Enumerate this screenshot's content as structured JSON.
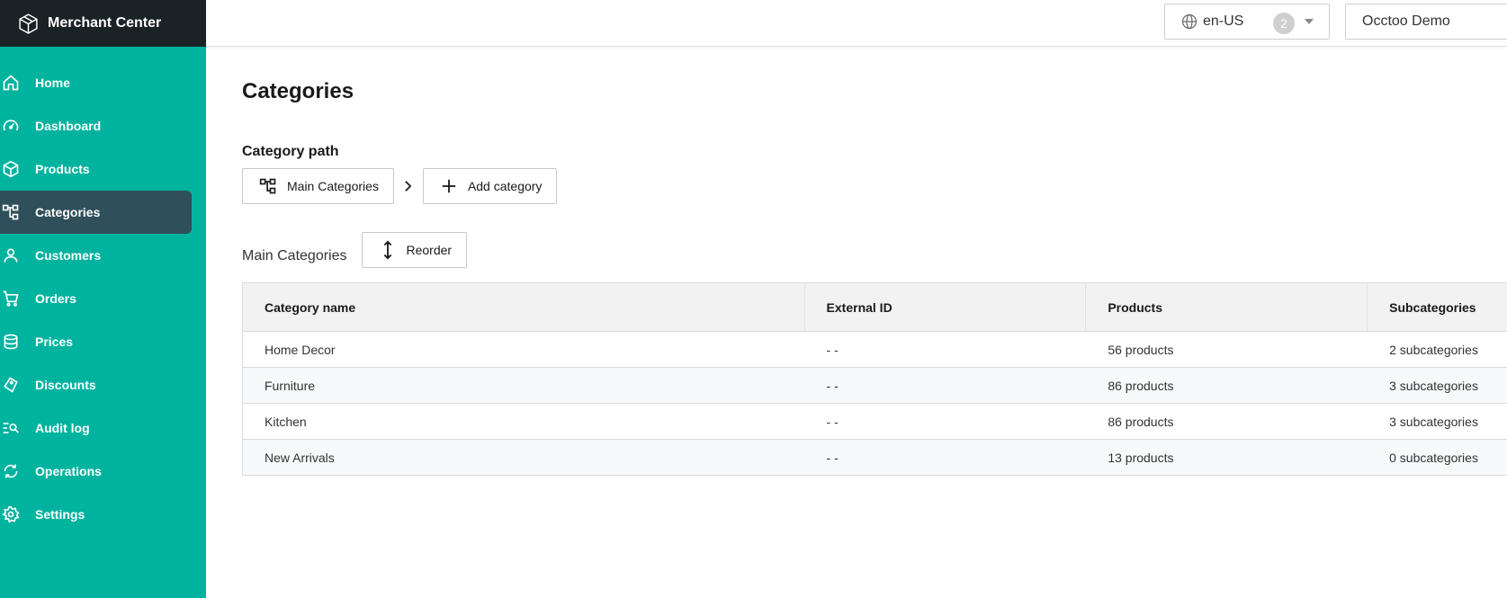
{
  "brand": {
    "title": "Merchant Center",
    "logo_icon": "cube-logo-icon"
  },
  "colors": {
    "sidebar_bg": "#00b39f",
    "brand_bg": "#1a2226",
    "active_item_bg": "#2f4f5a"
  },
  "sidebar": {
    "items": [
      {
        "label": "Home",
        "icon": "home-icon",
        "active": false
      },
      {
        "label": "Dashboard",
        "icon": "gauge-icon",
        "active": false
      },
      {
        "label": "Products",
        "icon": "box-icon",
        "active": false
      },
      {
        "label": "Categories",
        "icon": "hierarchy-icon",
        "active": true
      },
      {
        "label": "Customers",
        "icon": "user-icon",
        "active": false
      },
      {
        "label": "Orders",
        "icon": "cart-icon",
        "active": false
      },
      {
        "label": "Prices",
        "icon": "coins-icon",
        "active": false
      },
      {
        "label": "Discounts",
        "icon": "tag-icon",
        "active": false
      },
      {
        "label": "Audit log",
        "icon": "search-list-icon",
        "active": false
      },
      {
        "label": "Operations",
        "icon": "sync-icon",
        "active": false
      },
      {
        "label": "Settings",
        "icon": "gear-icon",
        "active": false
      }
    ]
  },
  "topbar": {
    "language": {
      "value": "en-US",
      "badge_count": "2"
    },
    "tenant": {
      "value": "Occtoo Demo"
    }
  },
  "main": {
    "title": "Categories",
    "path_label": "Category path",
    "path_button": "Main Categories",
    "add_button": "Add category",
    "section_label": "Main Categories",
    "reorder_button": "Reorder",
    "table": {
      "headers": [
        "Category name",
        "External ID",
        "Products",
        "Subcategories"
      ],
      "rows": [
        [
          "Home Decor",
          "- -",
          "56 products",
          "2 subcategories"
        ],
        [
          "Furniture",
          "- -",
          "86 products",
          "3 subcategories"
        ],
        [
          "Kitchen",
          "- -",
          "86 products",
          "3 subcategories"
        ],
        [
          "New Arrivals",
          "- -",
          "13 products",
          "0 subcategories"
        ]
      ]
    }
  }
}
